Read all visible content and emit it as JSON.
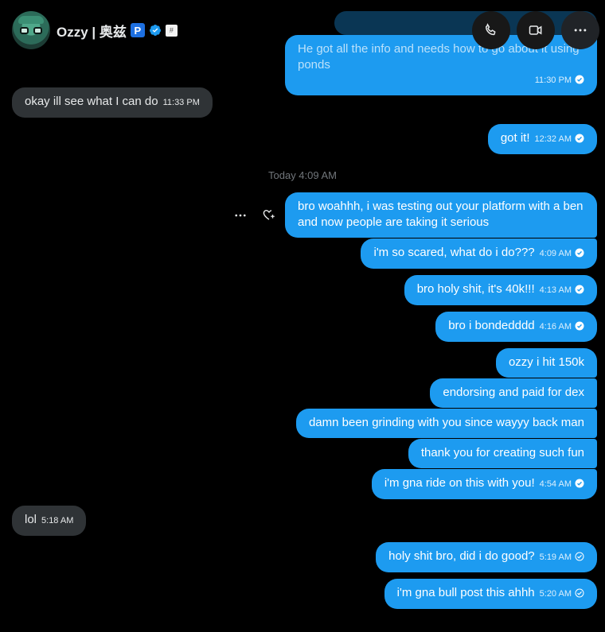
{
  "header": {
    "name": "Ozzy | 奥兹",
    "p_badge": "P",
    "mini_badge": "#"
  },
  "icons": [
    "phone-icon",
    "video-icon",
    "more-icon",
    "heart-plus-icon",
    "verified-icon",
    "read-check-icon",
    "sent-check-icon"
  ],
  "colors": {
    "sent": "#1d9bf0",
    "received": "#2f3336",
    "background": "#000000"
  },
  "day_separator": "Today 4:09 AM",
  "messages": [
    {
      "text": "He got all the info and needs how to go about it using ponds",
      "time": "11:30 PM",
      "dir": "sent"
    },
    {
      "text": "okay ill see what I can do",
      "time": "11:33 PM",
      "dir": "received"
    },
    {
      "text": "got it!",
      "time": "12:32 AM",
      "dir": "sent"
    },
    {
      "text": "bro woahhh, i was testing out your platform with a ben and now people are taking it serious",
      "time": "",
      "dir": "sent"
    },
    {
      "text": "i'm so scared, what do i do???",
      "time": "4:09 AM",
      "dir": "sent"
    },
    {
      "text": "bro holy shit, it's 40k!!!",
      "time": "4:13 AM",
      "dir": "sent"
    },
    {
      "text": "bro i bondedddd",
      "time": "4:16 AM",
      "dir": "sent"
    },
    {
      "text": "ozzy i hit 150k",
      "time": "",
      "dir": "sent"
    },
    {
      "text": "endorsing and paid for dex",
      "time": "",
      "dir": "sent"
    },
    {
      "text": "damn been grinding with you since wayyy back man",
      "time": "",
      "dir": "sent"
    },
    {
      "text": "thank you for creating such fun",
      "time": "",
      "dir": "sent"
    },
    {
      "text": "i'm gna ride on this with you!",
      "time": "4:54 AM",
      "dir": "sent"
    },
    {
      "text": "lol",
      "time": "5:18 AM",
      "dir": "received"
    },
    {
      "text": "holy shit bro, did i do good?",
      "time": "5:19 AM",
      "dir": "sent"
    },
    {
      "text": "i'm gna bull post this ahhh",
      "time": "5:20 AM",
      "dir": "sent"
    }
  ]
}
